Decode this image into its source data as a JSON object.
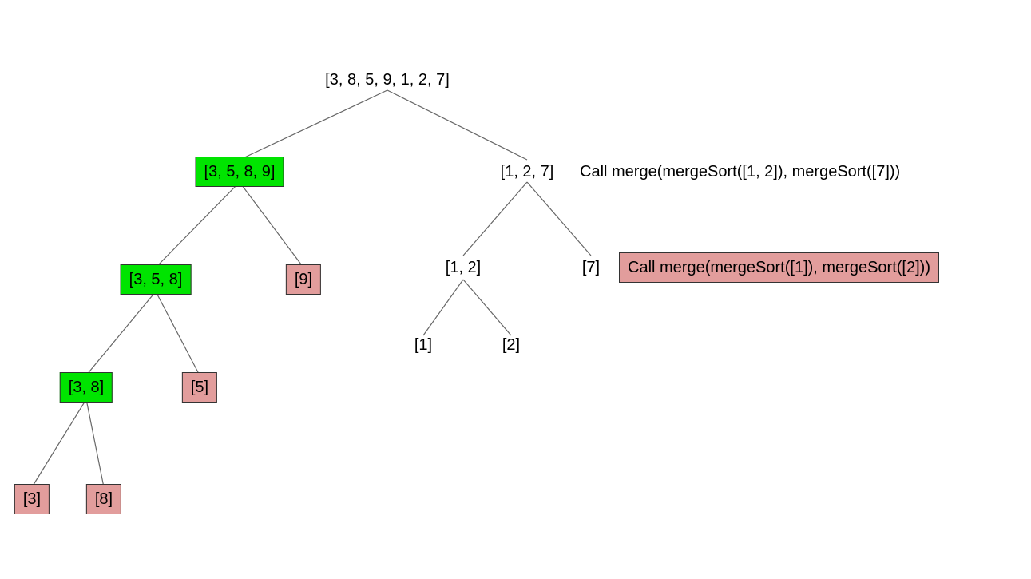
{
  "colors": {
    "green": "#00e400",
    "pink": "#e29d9c",
    "edge": "#666666"
  },
  "nodes": {
    "root": {
      "label": "[3, 8, 5, 9, 1, 2, 7]",
      "style": "plain"
    },
    "L": {
      "label": "[3, 5, 8, 9]",
      "style": "green"
    },
    "R": {
      "label": "[1, 2, 7]",
      "style": "plain"
    },
    "LL": {
      "label": "[3, 5, 8]",
      "style": "green"
    },
    "LR": {
      "label": "[9]",
      "style": "pink"
    },
    "LLL": {
      "label": "[3, 8]",
      "style": "green"
    },
    "LLR": {
      "label": "[5]",
      "style": "pink"
    },
    "LLLL": {
      "label": "[3]",
      "style": "pink"
    },
    "LLLR": {
      "label": "[8]",
      "style": "pink"
    },
    "RL": {
      "label": "[1, 2]",
      "style": "plain"
    },
    "RR": {
      "label": "[7]",
      "style": "plain"
    },
    "RLL": {
      "label": "[1]",
      "style": "plain"
    },
    "RLR": {
      "label": "[2]",
      "style": "plain"
    }
  },
  "annotations": {
    "annR": {
      "label": "Call merge(mergeSort([1, 2]), mergeSort([7]))",
      "style": "plain"
    },
    "annRL": {
      "label": "Call merge(mergeSort([1]), mergeSort([2]))",
      "style": "pink"
    }
  }
}
